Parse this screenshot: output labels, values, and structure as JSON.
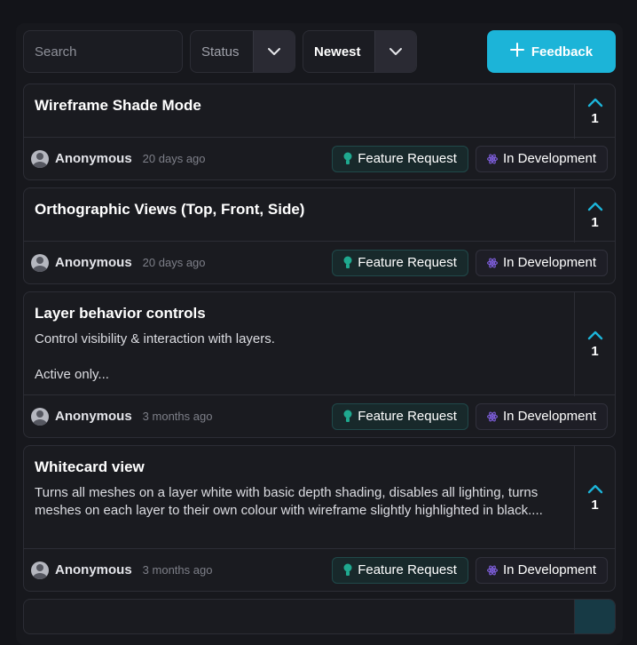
{
  "toolbar": {
    "search_placeholder": "Search",
    "status_label": "Status",
    "sort_label": "Newest",
    "feedback_label": "Feedback"
  },
  "colors": {
    "accent": "#1cb4d8",
    "background": "#131419",
    "card": "#1a1b20",
    "feature_tag_icon": "#1fa98f",
    "status_tag_icon": "#7b5cd6"
  },
  "posts": [
    {
      "title": "Wireframe Shade Mode",
      "description": [],
      "votes": "1",
      "author": "Anonymous",
      "time": "20 days ago",
      "category": "Feature Request",
      "status": "In Development"
    },
    {
      "title": "Orthographic Views (Top, Front, Side)",
      "description": [],
      "votes": "1",
      "author": "Anonymous",
      "time": "20 days ago",
      "category": "Feature Request",
      "status": "In Development"
    },
    {
      "title": "Layer behavior controls",
      "description": [
        "Control visibility & interaction with layers.",
        "Active only..."
      ],
      "votes": "1",
      "author": "Anonymous",
      "time": "3 months ago",
      "category": "Feature Request",
      "status": "In Development"
    },
    {
      "title": "Whitecard view",
      "description": [
        "Turns all meshes on a layer white with basic depth shading, disables all lighting, turns meshes on each layer to their own colour with wireframe slightly highlighted in black...."
      ],
      "votes": "1",
      "author": "Anonymous",
      "time": "3 months ago",
      "category": "Feature Request",
      "status": "In Development"
    }
  ],
  "icons": {
    "upvote": "chevron-up-icon",
    "dropdown": "chevron-down-icon",
    "add": "plus-icon",
    "category": "lightbulb-icon",
    "status": "atom-icon",
    "avatar": "user-avatar-icon"
  }
}
